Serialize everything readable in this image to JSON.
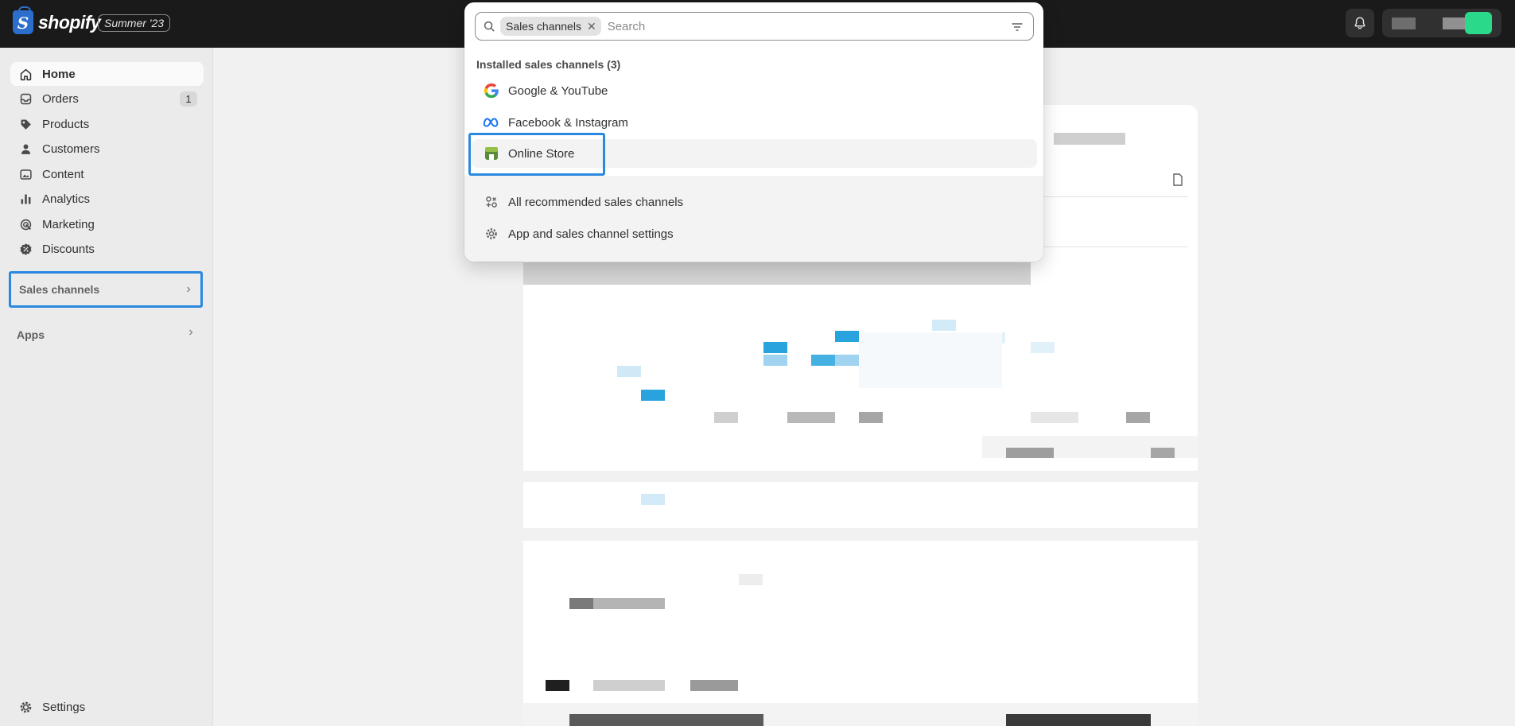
{
  "topbar": {
    "brand": "shopify",
    "brand_glyph": "S",
    "edition_badge": "Summer '23",
    "icons": {
      "notifications": "bell-icon"
    }
  },
  "sidebar": {
    "items": [
      {
        "label": "Home",
        "icon": "home-icon",
        "active": true
      },
      {
        "label": "Orders",
        "icon": "orders-icon",
        "count": "1"
      },
      {
        "label": "Products",
        "icon": "tag-icon"
      },
      {
        "label": "Customers",
        "icon": "person-icon"
      },
      {
        "label": "Content",
        "icon": "content-icon"
      },
      {
        "label": "Analytics",
        "icon": "bar-chart-icon"
      },
      {
        "label": "Marketing",
        "icon": "target-icon"
      },
      {
        "label": "Discounts",
        "icon": "discount-icon"
      }
    ],
    "sections": [
      {
        "label": "Sales channels",
        "highlighted": true
      },
      {
        "label": "Apps"
      }
    ],
    "settings": {
      "label": "Settings",
      "icon": "gear-icon"
    }
  },
  "search_popover": {
    "filter_tag": "Sales channels",
    "placeholder": "Search",
    "heading": "Installed sales channels (3)",
    "channels": [
      {
        "label": "Google & YouTube",
        "icon": "google-icon"
      },
      {
        "label": "Facebook & Instagram",
        "icon": "meta-icon"
      },
      {
        "label": "Online Store",
        "icon": "online-store-icon",
        "highlighted": true
      }
    ],
    "footer_links": [
      {
        "label": "All recommended sales channels",
        "icon": "apps-icon"
      },
      {
        "label": "App and sales channel settings",
        "icon": "gear-icon"
      }
    ]
  },
  "colors": {
    "topbar": "#1a1a1a",
    "highlight": "#2b88e0",
    "avatar": "#2bd98a",
    "chart_blue": "#29a3dd"
  }
}
